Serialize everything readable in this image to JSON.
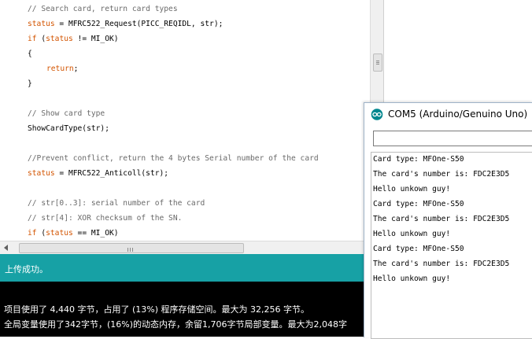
{
  "editor": {
    "lines": [
      {
        "parts": [
          [
            "comment",
            "// Search card, return card types"
          ]
        ]
      },
      {
        "parts": [
          [
            "kw",
            "status"
          ],
          [
            "plain",
            " = MFRC522_Request(PICC_REQIDL, str);"
          ]
        ]
      },
      {
        "parts": [
          [
            "kw",
            "if"
          ],
          [
            "plain",
            " ("
          ],
          [
            "kw",
            "status"
          ],
          [
            "plain",
            " != MI_OK)"
          ]
        ]
      },
      {
        "parts": [
          [
            "plain",
            "{"
          ]
        ]
      },
      {
        "parts": [
          [
            "ret",
            "return"
          ],
          [
            "plain",
            ";"
          ]
        ]
      },
      {
        "parts": [
          [
            "plain",
            "}"
          ]
        ]
      },
      {
        "parts": []
      },
      {
        "parts": [
          [
            "comment",
            "// Show card type"
          ]
        ]
      },
      {
        "parts": [
          [
            "plain",
            "ShowCardType(str);"
          ]
        ]
      },
      {
        "parts": []
      },
      {
        "parts": [
          [
            "comment",
            "//Prevent conflict, return the 4 bytes Serial number of the card"
          ]
        ]
      },
      {
        "parts": [
          [
            "kw",
            "status"
          ],
          [
            "plain",
            " = MFRC522_Anticoll(str);"
          ]
        ]
      },
      {
        "parts": []
      },
      {
        "parts": [
          [
            "comment",
            "// str[0..3]: serial number of the card"
          ]
        ]
      },
      {
        "parts": [
          [
            "comment",
            "// str[4]: XOR checksum of the SN."
          ]
        ]
      },
      {
        "parts": [
          [
            "kw",
            "if"
          ],
          [
            "plain",
            " ("
          ],
          [
            "kw",
            "status"
          ],
          [
            "plain",
            " == MI_OK)"
          ]
        ]
      }
    ]
  },
  "status_bar": {
    "message": "上传成功。",
    "background": "#17a1a5"
  },
  "console": {
    "line1": "项目使用了 4,440 字节，占用了 (13%) 程序存储空间。最大为 32,256 字节。",
    "line2": "全局变量使用了342字节，(16%)的动态内存，余留1,706字节局部变量。最大为2,048字"
  },
  "serial_monitor": {
    "title": "COM5 (Arduino/Genuino Uno)",
    "input_value": "",
    "lines": [
      "Card type: MFOne-S50",
      "The card's number is: FDC2E3D5",
      "Hello unkown guy!",
      "Card type: MFOne-S50",
      "The card's number is: FDC2E3D5",
      "Hello unkown guy!",
      "Card type: MFOne-S50",
      "The card's number is: FDC2E3D5",
      "Hello unkown guy!"
    ]
  },
  "icons": {
    "serial_logo": "arduino-logo-icon"
  },
  "colors": {
    "keyword": "#d35400",
    "comment": "#6a6a6a",
    "console_bg": "#000000",
    "accent": "#17a1a5"
  }
}
